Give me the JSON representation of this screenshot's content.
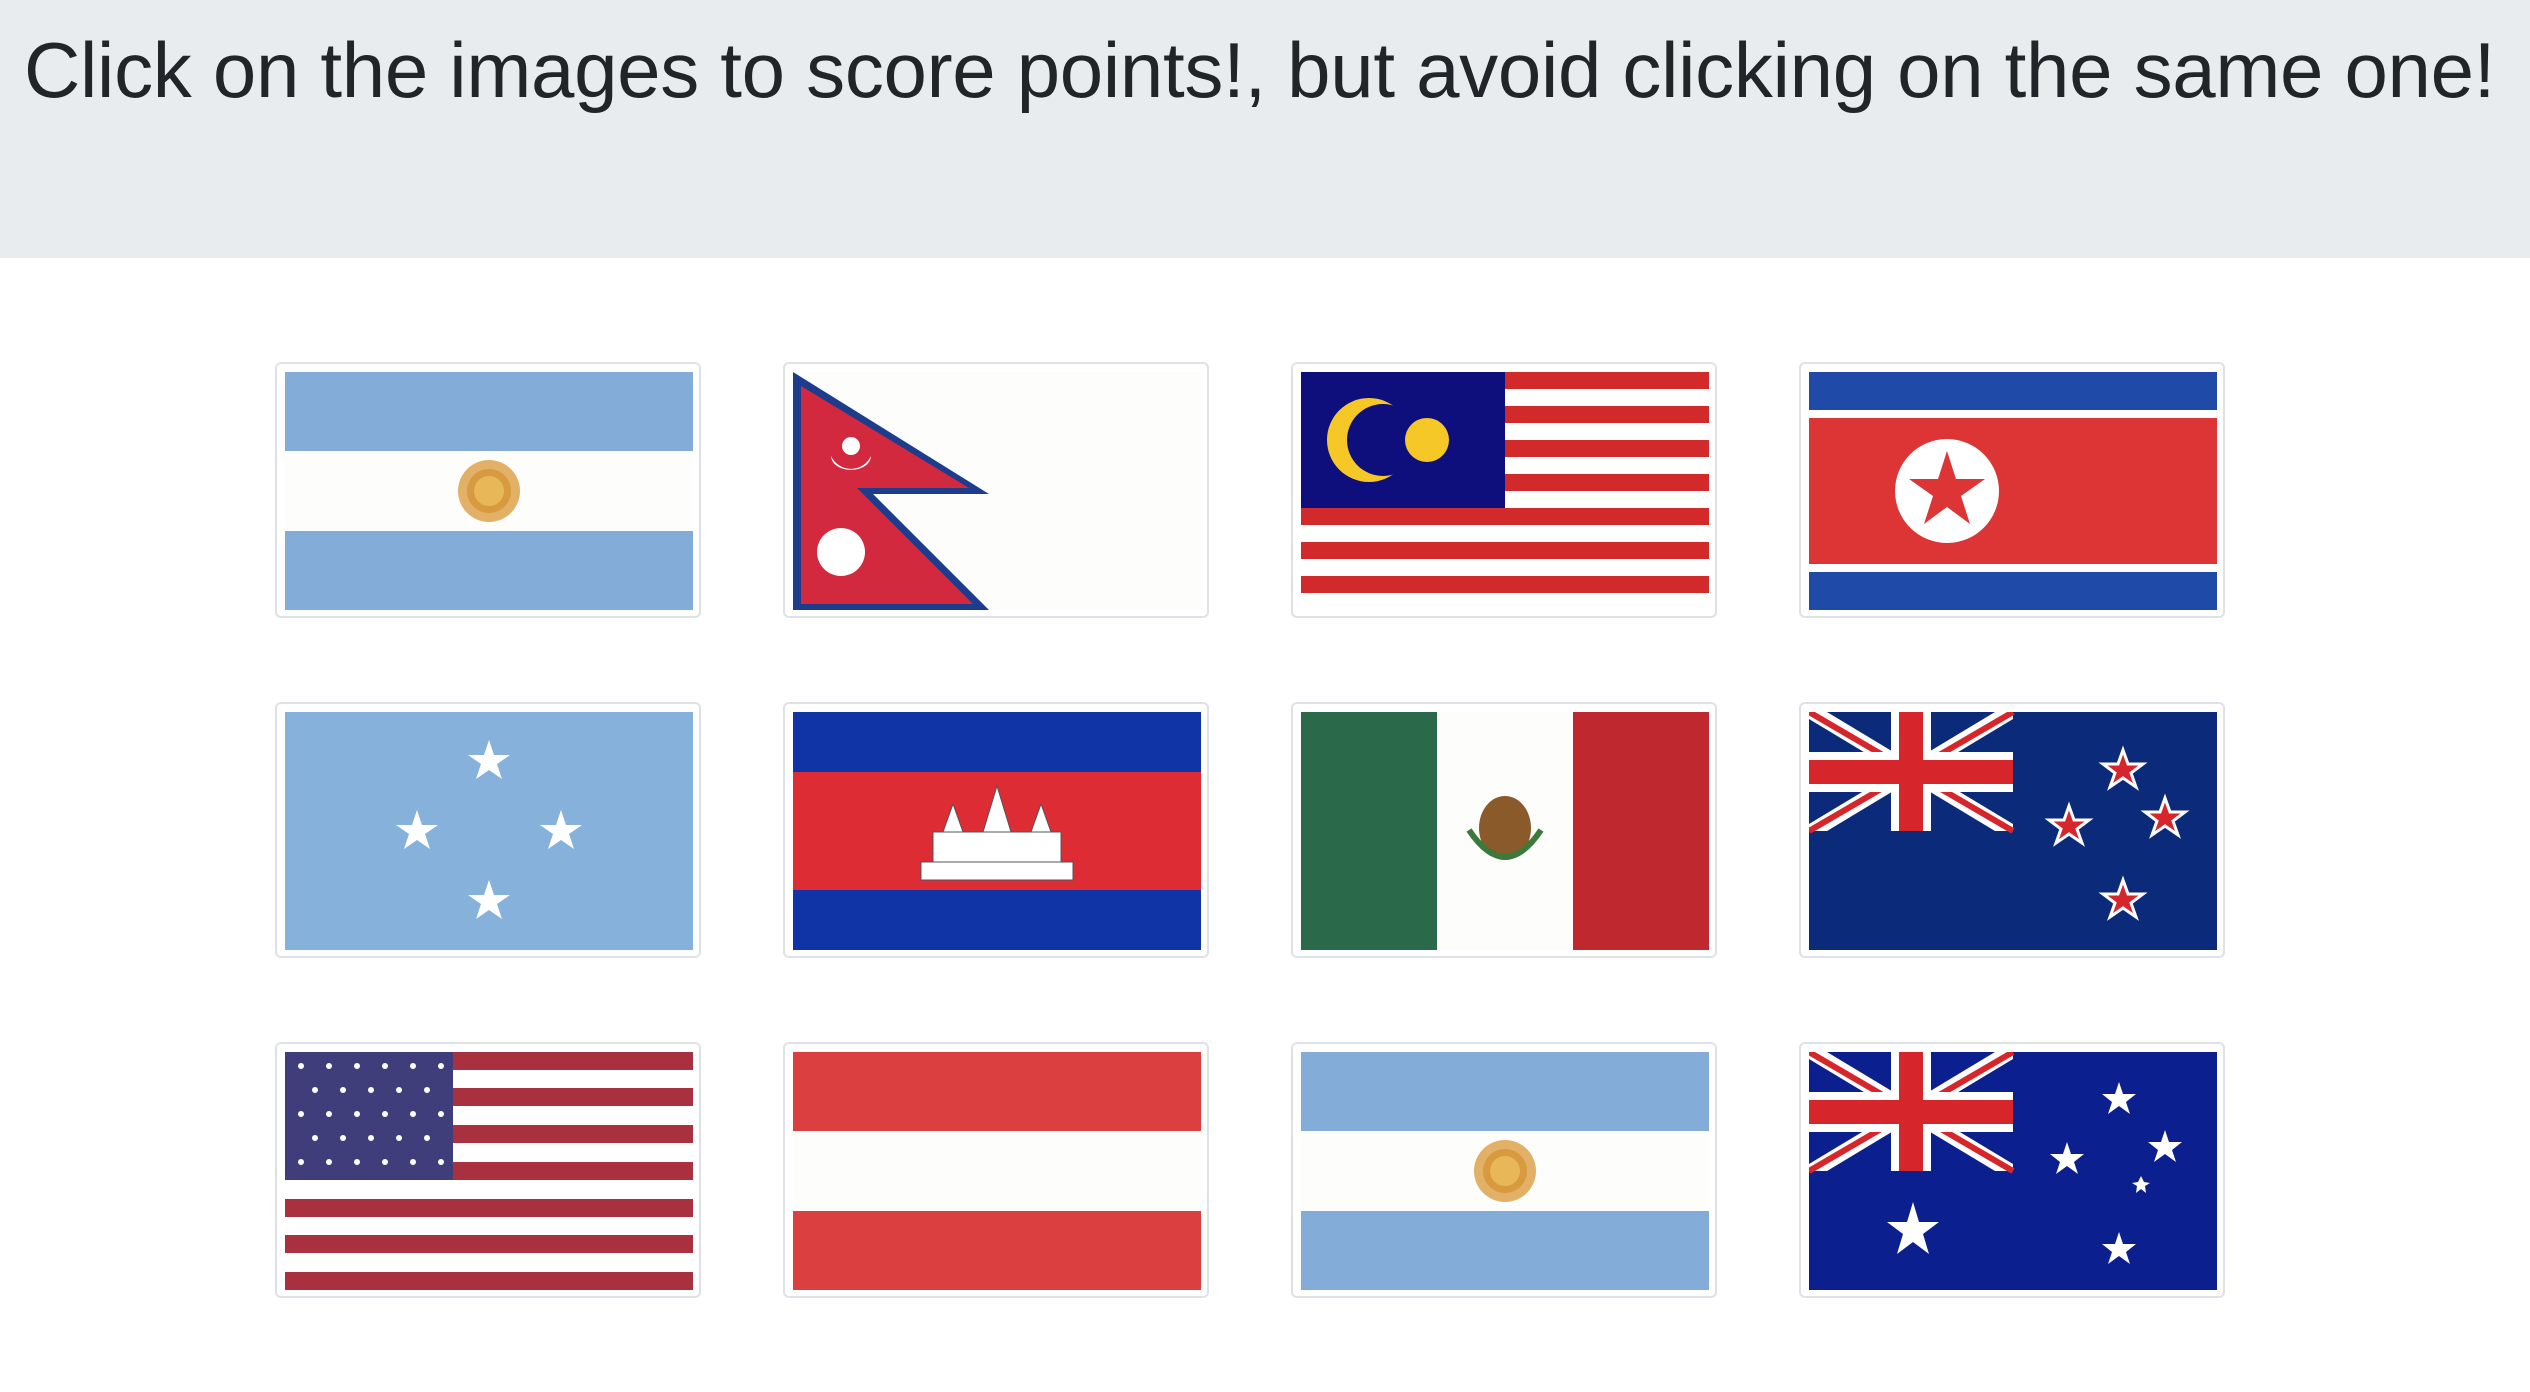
{
  "header": {
    "title": "Click on the images to score points!, but avoid clicking on the same one!"
  },
  "flags": [
    {
      "country": "Argentina"
    },
    {
      "country": "Nepal"
    },
    {
      "country": "Malaysia"
    },
    {
      "country": "North Korea"
    },
    {
      "country": "Micronesia"
    },
    {
      "country": "Cambodia"
    },
    {
      "country": "Mexico"
    },
    {
      "country": "New Zealand"
    },
    {
      "country": "United States"
    },
    {
      "country": "Austria"
    },
    {
      "country": "Argentina"
    },
    {
      "country": "Australia"
    }
  ]
}
